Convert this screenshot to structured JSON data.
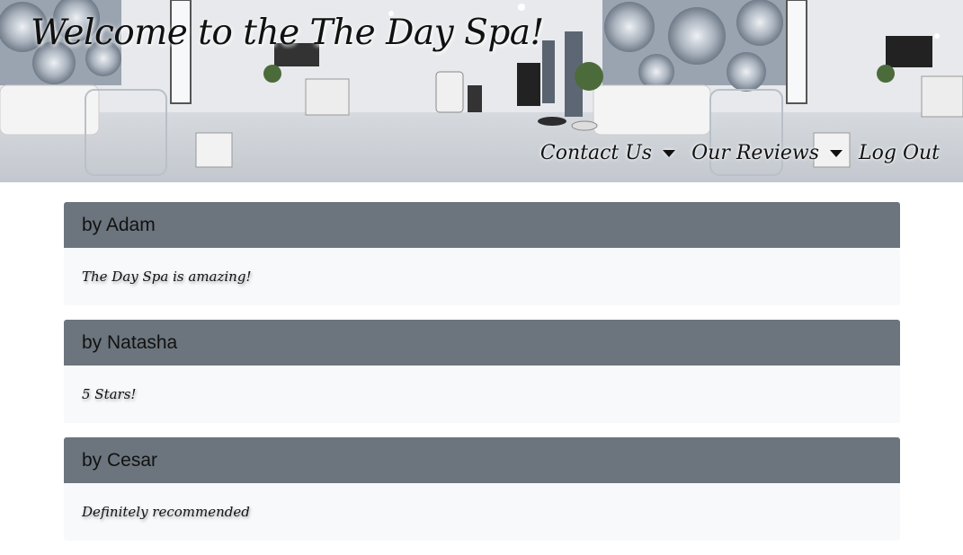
{
  "header": {
    "title": "Welcome to the The Day Spa!"
  },
  "nav": {
    "items": [
      {
        "label": "Contact Us",
        "dropdown": true
      },
      {
        "label": "Our Reviews",
        "dropdown": true
      },
      {
        "label": "Log Out",
        "dropdown": false
      }
    ]
  },
  "reviews": [
    {
      "author": "by Adam",
      "text": "The Day Spa is amazing!"
    },
    {
      "author": "by Natasha",
      "text": "5 Stars!"
    },
    {
      "author": "by Cesar",
      "text": "Definitely recommended"
    }
  ],
  "colors": {
    "card_header": "#6c757d",
    "card_body": "#f8f9fa",
    "text": "#111111"
  }
}
